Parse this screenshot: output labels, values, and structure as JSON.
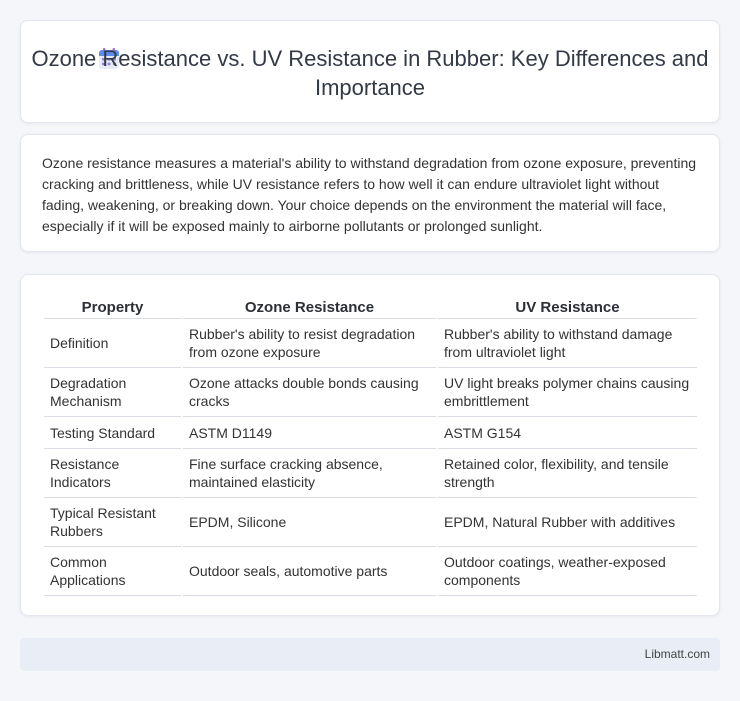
{
  "header": {
    "title": "Ozone Resistance vs. UV Resistance in Rubber: Key Differences and Importance",
    "icon": "calendar-icon"
  },
  "intro": {
    "text": "Ozone resistance measures a material's ability to withstand degradation from ozone exposure, preventing cracking and brittleness, while UV resistance refers to how well it can endure ultraviolet light without fading, weakening, or breaking down. Your choice depends on the environment the material will face, especially if it will be exposed mainly to airborne pollutants or prolonged sunlight."
  },
  "table": {
    "headers": [
      "Property",
      "Ozone Resistance",
      "UV Resistance"
    ],
    "rows": [
      [
        "Definition",
        "Rubber's ability to resist degradation from ozone exposure",
        "Rubber's ability to withstand damage from ultraviolet light"
      ],
      [
        "Degradation Mechanism",
        "Ozone attacks double bonds causing cracks",
        "UV light breaks polymer chains causing embrittlement"
      ],
      [
        "Testing Standard",
        "ASTM D1149",
        "ASTM G154"
      ],
      [
        "Resistance Indicators",
        "Fine surface cracking absence, maintained elasticity",
        "Retained color, flexibility, and tensile strength"
      ],
      [
        "Typical Resistant Rubbers",
        "EPDM, Silicone",
        "EPDM, Natural Rubber with additives"
      ],
      [
        "Common Applications",
        "Outdoor seals, automotive parts",
        "Outdoor coatings, weather-exposed components"
      ]
    ]
  },
  "footer": {
    "site": "Libmatt.com"
  }
}
